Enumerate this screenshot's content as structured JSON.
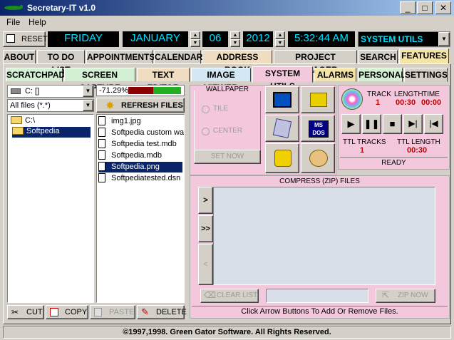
{
  "window": {
    "title": "Secretary-IT v1.0",
    "minimize": "_",
    "maximize": "□",
    "close": "✕"
  },
  "menu": {
    "file": "File",
    "help": "Help"
  },
  "toolbar": {
    "reset_label": "RESET",
    "day": "FRIDAY",
    "month": "JANUARY",
    "date": "06",
    "year": "2012",
    "time": "5:32:44 AM",
    "section_select": "SYSTEM UTILS"
  },
  "main_tabs": [
    "ABOUT",
    "TO DO LIST",
    "APPOINTMENTS",
    "CALENDAR",
    "ADDRESS BOOK",
    "PROJECT MANAGER",
    "SEARCH",
    "FEATURES"
  ],
  "sub_tabs": [
    "SCRATCHPAD",
    "SCREEN CAPTURE",
    "TEXT EDITOR",
    "IMAGE VIEWER",
    "SYSTEM UTILS",
    "ALARMS",
    "PERSONAL",
    "SETTINGS"
  ],
  "drive": {
    "value": "C: []"
  },
  "disk_usage": {
    "percent_label": "-71.29%",
    "used_fraction": 0.71
  },
  "filter": {
    "value": "All files (*.*)"
  },
  "refresh_label": "REFRESH FILES",
  "folders": [
    "C:\\",
    "Softpedia"
  ],
  "files": [
    "img1.jpg",
    "Softpedia custom wa",
    "Softpedia test.mdb",
    "Softpedia.mdb",
    "Softpedia.png",
    "Softpediatested.dsn"
  ],
  "selected_file": "Softpedia.png",
  "file_actions": {
    "cut": "CUT",
    "copy": "COPY",
    "paste": "PASTE",
    "delete": "DELETE"
  },
  "wallpaper": {
    "title": "WALLPAPER",
    "tile": "TILE",
    "center": "CENTER",
    "set_now": "SET NOW"
  },
  "tools": {
    "msdos": "MS DOS"
  },
  "cd": {
    "track_label": "TRACK",
    "length_label": "LENGTH",
    "time_label": "TIME",
    "track": "1",
    "length": "00:30",
    "time": "00:00",
    "ttl_tracks_label": "TTL TRACKS",
    "ttl_length_label": "TTL LENGTH",
    "ttl_tracks": "1",
    "ttl_length": "00:30",
    "status": "READY"
  },
  "zip": {
    "title": "COMPRESS (ZIP) FILES",
    "add_one": ">",
    "add_all": ">>",
    "remove": "<",
    "clear_list": "CLEAR LIST",
    "zip_now": "ZIP NOW",
    "hint": "Click Arrow Buttons To Add Or Remove Files."
  },
  "footer": "©1997,1998.  Green Gator Software.  All Rights Reserved."
}
